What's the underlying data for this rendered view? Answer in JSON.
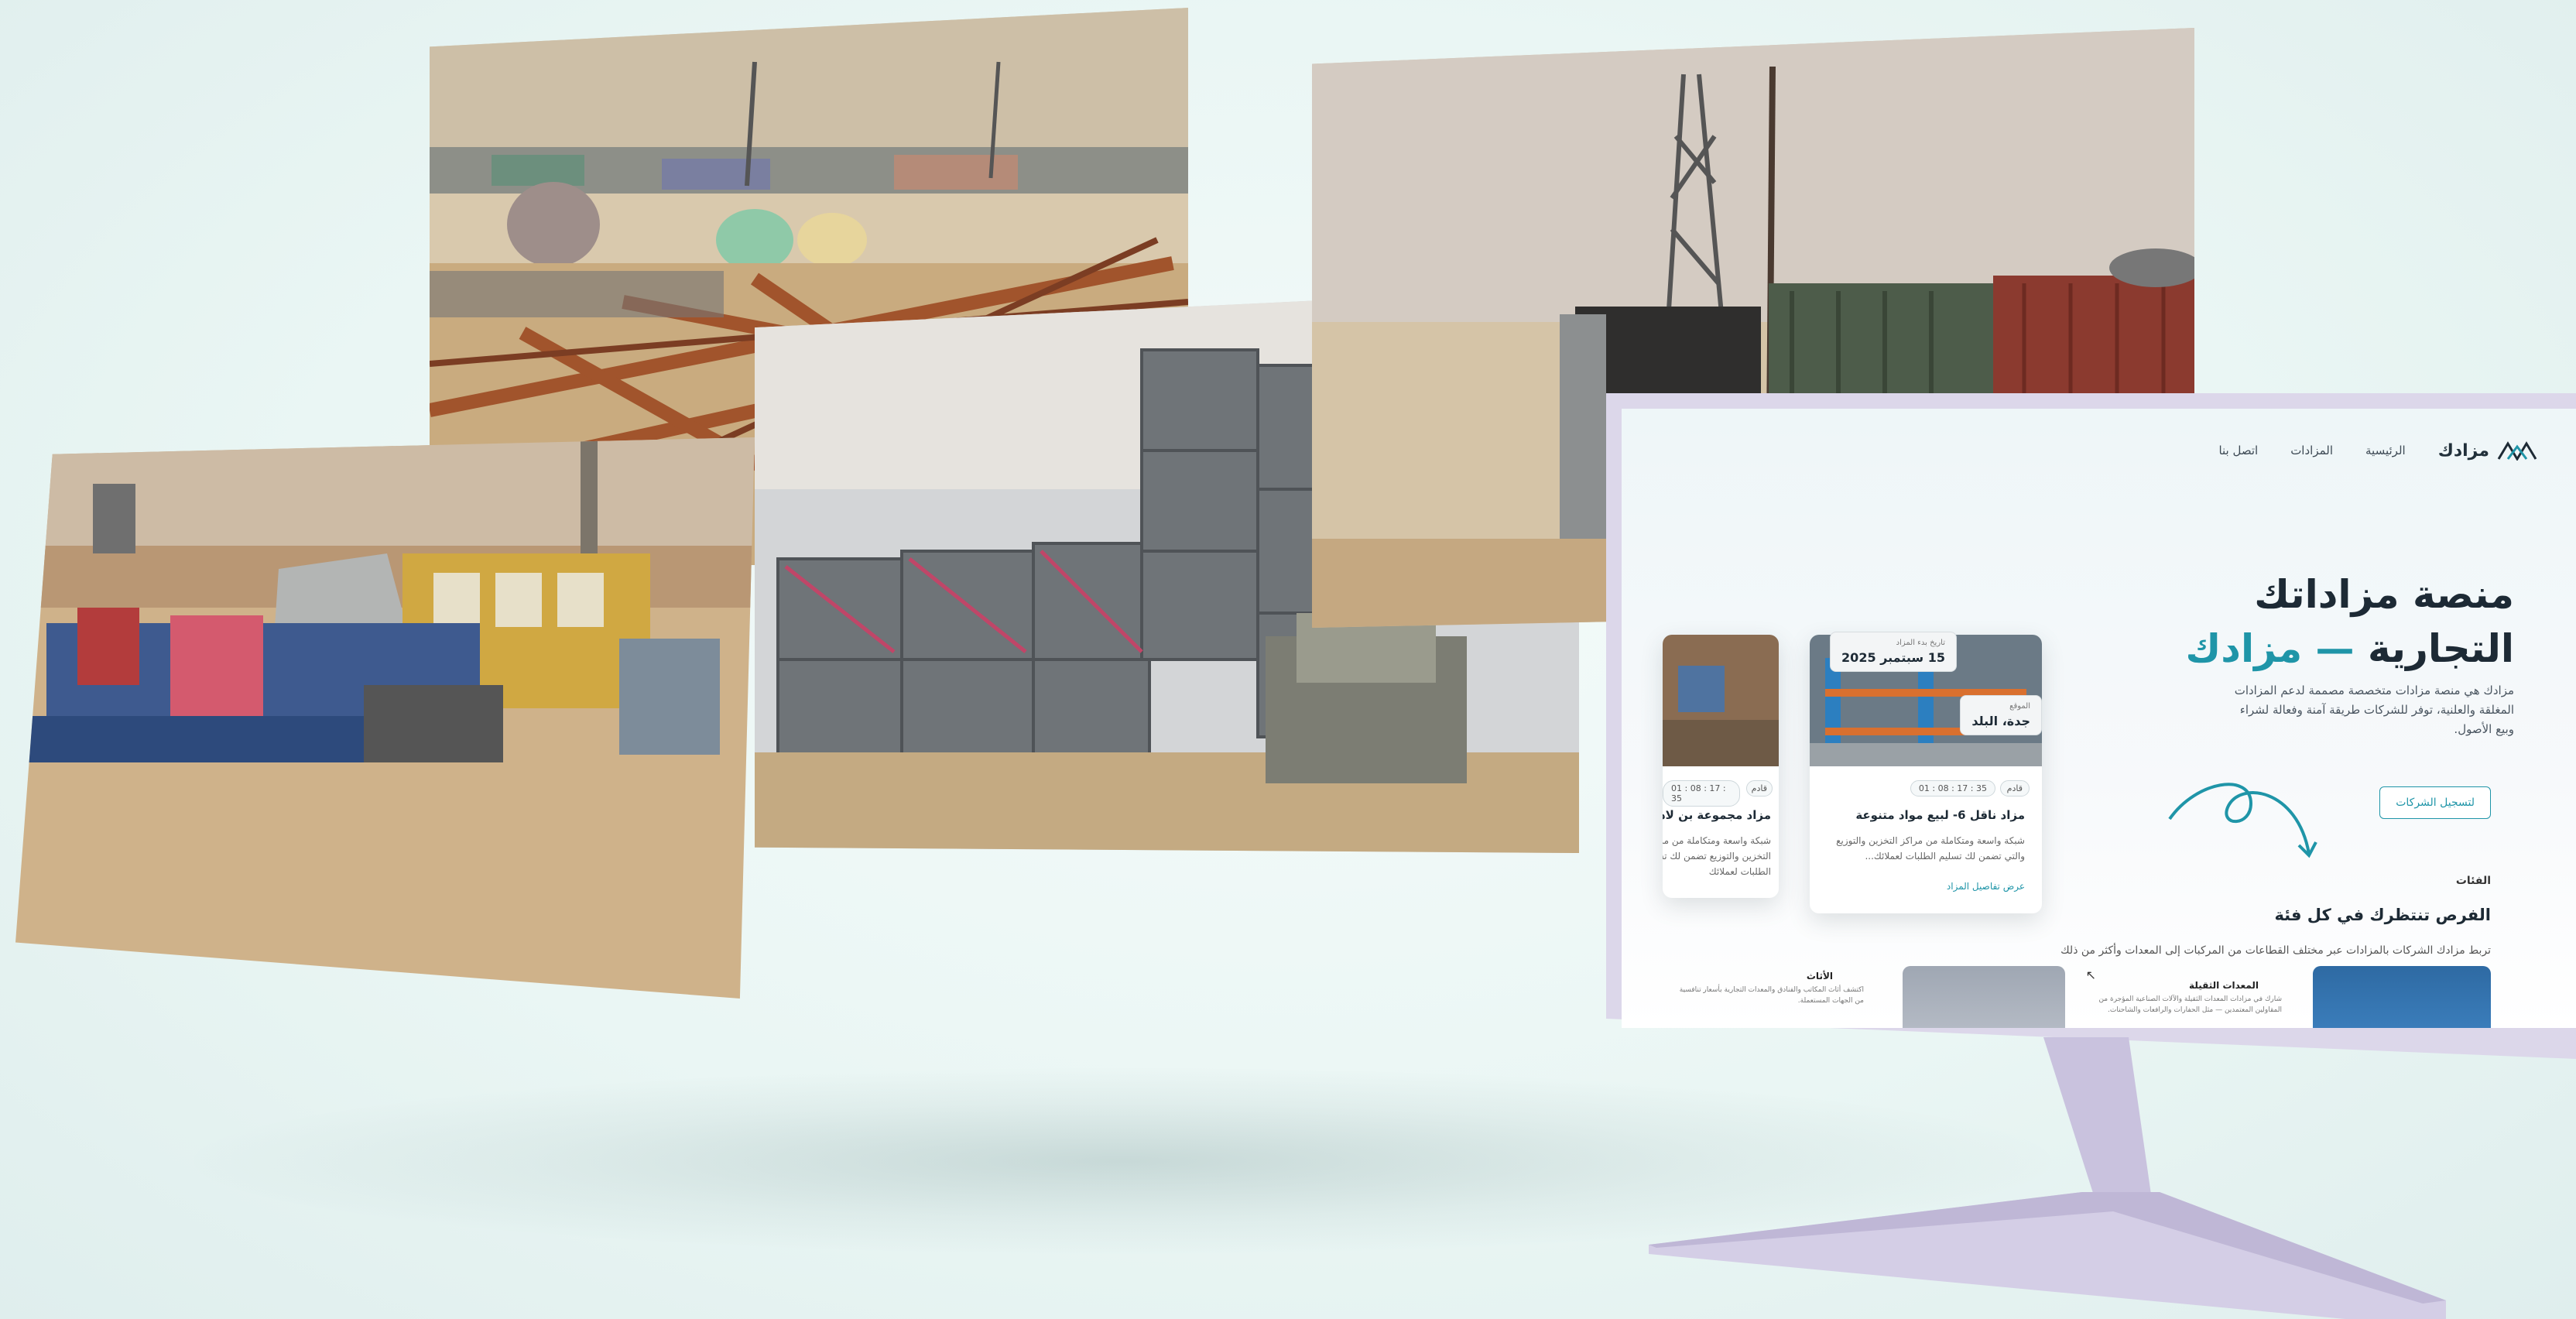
{
  "site": {
    "logo_text": "مزادك",
    "nav": [
      "الرئيسية",
      "المزادات",
      "اتصل بنا"
    ]
  },
  "hero": {
    "title_line1": "منصة مزاداتك",
    "title_line2_main": "التجارية",
    "title_line2_accent": "— مزادك",
    "description": "مزادك هي منصة مزادات متخصصة مصممة لدعم المزادات المغلقة والعلنية، توفر للشركات طريقة آمنة وفعالة لشراء وبيع الأصول.",
    "cta": "لتسجيل الشركات"
  },
  "categories": {
    "label": "الفئات",
    "title": "الفرص تنتظرك في كل فئة",
    "subtitle": "تربط مزادك الشركات بالمزادات عبر مختلف القطاعات من المركبات إلى المعدات وأكثر من ذلك",
    "items": [
      {
        "title": "المعدات الثقيلة",
        "body": "شارك في مزادات المعدات الثقيلة والآلات الصناعية المؤجرة من المقاولين المعتمدين — مثل الحفارات والرافعات والشاحنات."
      },
      {
        "title": "الأثاث",
        "body": "اكتشف أثاث المكاتب والفنادق والمعدات التجارية بأسعار تنافسية من الجهات المستعملة."
      }
    ]
  },
  "auctions": [
    {
      "timer": "01 : 08 : 17 : 35",
      "status": "قادم",
      "title": "مزاد ناقل 6- لبيع مواد متنوعة",
      "body": "شبكة واسعة ومتكاملة من مراكز التخزين والتوزيع والتي تضمن لك تسليم الطلبات لعملائك...",
      "link": "عرض تفاصيل المزاد",
      "location_label": "الموقع",
      "location_value": "جدة، البلد",
      "date_label": "تاريخ بدء المزاد",
      "date_value": "15 سبتمبر 2025"
    },
    {
      "timer": "01 : 08 : 17 : 35",
      "status": "قادم",
      "title": "مزاد مجموعة بن لادن",
      "body": "شبكة واسعة ومتكاملة من مراكز التخزين والتوزيع تضمن لك تسليم الطلبات لعملائك"
    }
  ],
  "colors": {
    "accent": "#1f95a8",
    "dark_text": "#1d2a35",
    "monitor_frame": "#dcd7ea"
  }
}
